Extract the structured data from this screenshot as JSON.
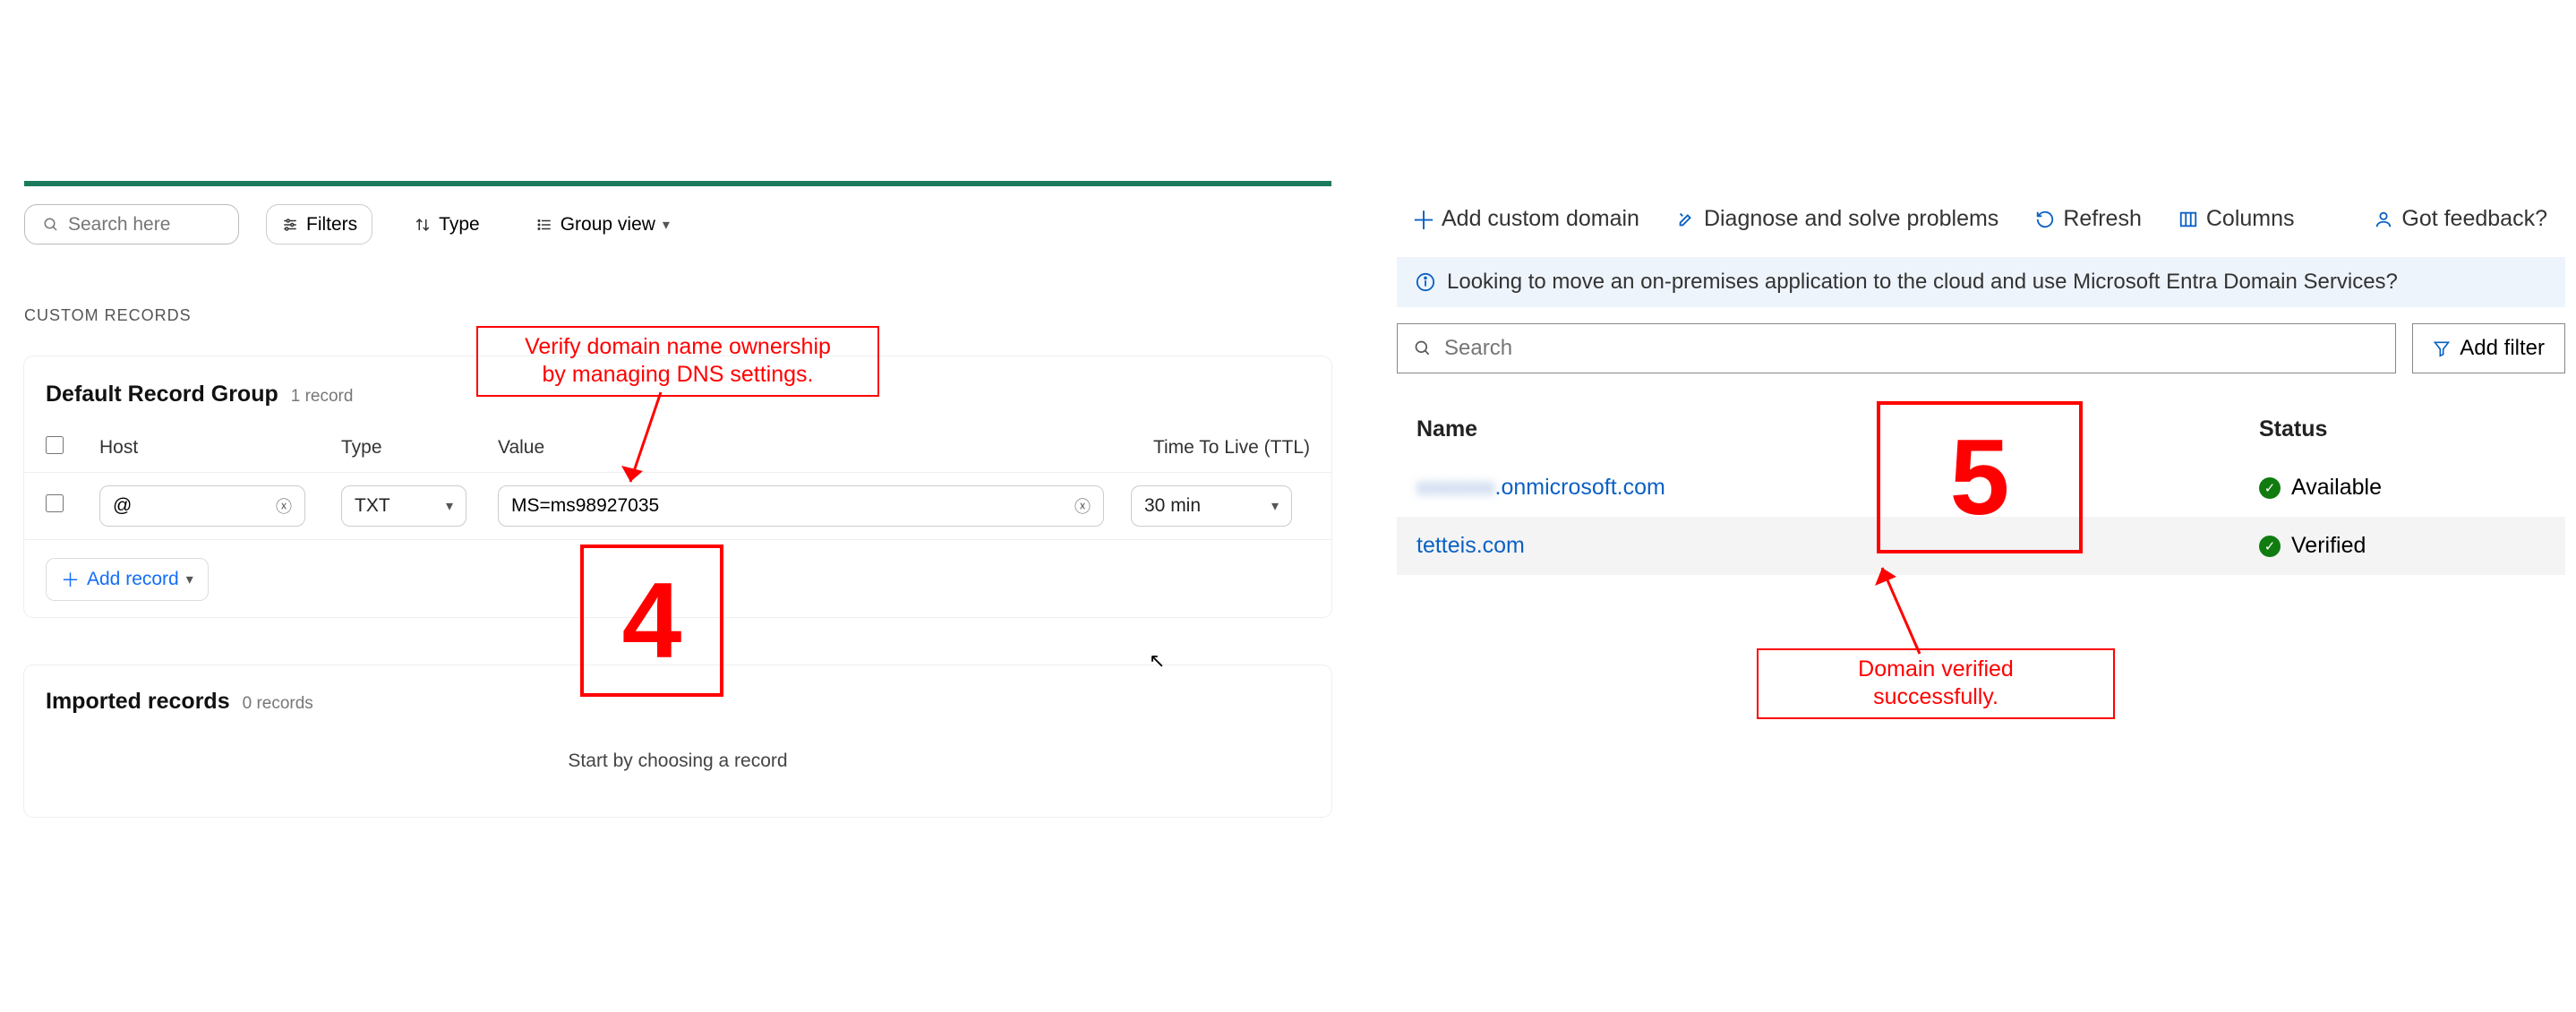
{
  "left": {
    "search_placeholder": "Search here",
    "filters_label": "Filters",
    "type_label": "Type",
    "group_view_label": "Group view",
    "section_label": "CUSTOM RECORDS",
    "group_title": "Default Record Group",
    "group_count": "1 record",
    "cols": {
      "host": "Host",
      "type": "Type",
      "value": "Value",
      "ttl": "Time To Live (TTL)"
    },
    "row": {
      "host": "@",
      "type": "TXT",
      "value": "MS=ms98927035",
      "ttl": "30 min"
    },
    "add_record": "Add record",
    "imported_title": "Imported records",
    "imported_count": "0 records",
    "imported_hint": "Start by choosing a record"
  },
  "right": {
    "toolbar": {
      "add": "Add custom domain",
      "diagnose": "Diagnose and solve problems",
      "refresh": "Refresh",
      "columns": "Columns",
      "feedback": "Got feedback?"
    },
    "info": "Looking to move an on-premises application to the cloud and use Microsoft Entra Domain Services?",
    "search_placeholder": "Search",
    "add_filter": "Add filter",
    "cols": {
      "name": "Name",
      "status": "Status"
    },
    "rows": [
      {
        "name_prefix": "xxxxxxx",
        "name_suffix": ".onmicrosoft.com",
        "status": "Available"
      },
      {
        "name_prefix": "tetteis.com",
        "name_suffix": "",
        "status": "Verified"
      }
    ]
  },
  "annotations": {
    "box4": "Verify domain name ownership\nby managing DNS settings.",
    "num4": "4",
    "num5": "5",
    "box5": "Domain verified\nsuccessfully."
  }
}
